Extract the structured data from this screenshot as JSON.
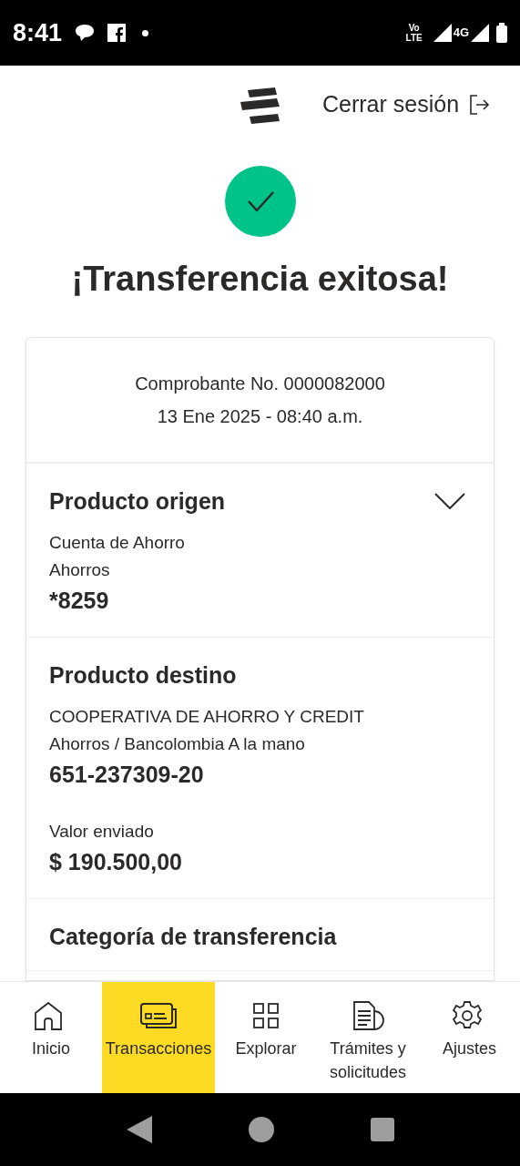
{
  "status_bar": {
    "time": "8:41",
    "volte": "Vo LTE",
    "network": "4G"
  },
  "header": {
    "logout": "Cerrar sesión"
  },
  "title": "¡Transferencia exitosa!",
  "receipt": {
    "number": "Comprobante No. 0000082000",
    "date": "13 Ene 2025 - 08:40 a.m."
  },
  "sections": [
    {
      "title": "Producto origen",
      "expanded": false,
      "groups": [
        [
          {
            "kind": "label",
            "text": "Cuenta de Ahorro"
          },
          {
            "kind": "label",
            "text": "Ahorros"
          },
          {
            "kind": "value",
            "text": "*8259"
          }
        ]
      ]
    },
    {
      "title": "Producto destino",
      "groups": [
        [
          {
            "kind": "label",
            "text": "COOPERATIVA DE AHORRO Y CREDIT"
          },
          {
            "kind": "label",
            "text": "Ahorros / Bancolombia A la mano"
          },
          {
            "kind": "value",
            "text": "651-237309-20"
          }
        ],
        [
          {
            "kind": "label",
            "text": "Valor enviado"
          },
          {
            "kind": "value",
            "text": "$ 190.500,00"
          }
        ]
      ]
    },
    {
      "title": "Categoría de transferencia"
    }
  ],
  "bottom_nav": [
    {
      "label": "Inicio",
      "selected": false
    },
    {
      "label": "Transacciones",
      "selected": true
    },
    {
      "label": "Explorar",
      "selected": false
    },
    {
      "label": "Trámites y solicitudes",
      "selected": false
    },
    {
      "label": "Ajustes",
      "selected": false
    }
  ]
}
